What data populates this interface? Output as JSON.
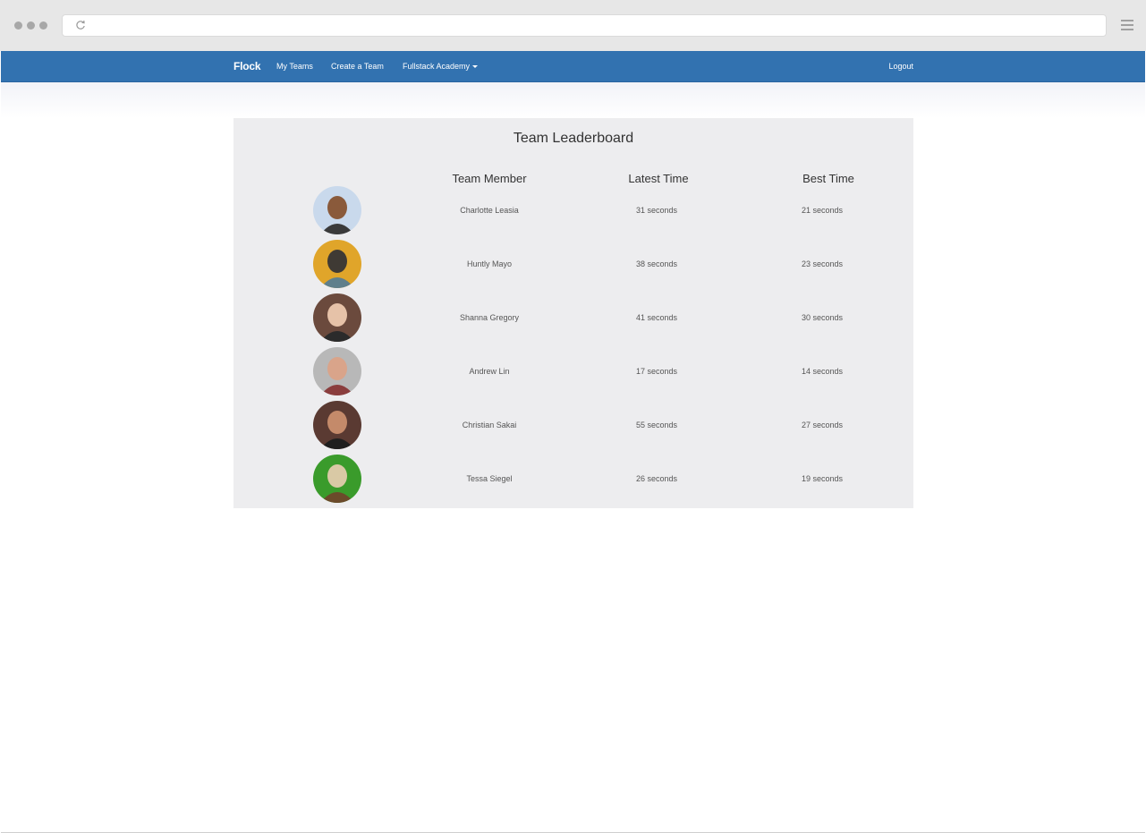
{
  "navbar": {
    "brand": "Flock",
    "links": [
      "My Teams",
      "Create a Team",
      "Fullstack Academy"
    ],
    "logout": "Logout"
  },
  "leaderboard": {
    "title": "Team Leaderboard",
    "headers": [
      "Team Member",
      "Latest Time",
      "Best Time"
    ],
    "rows": [
      {
        "name": "Charlotte Leasia",
        "latest": "31 seconds",
        "best": "21 seconds",
        "avatar_colors": [
          "#c9d9ec",
          "#8a5a3b",
          "#3a3a3a"
        ]
      },
      {
        "name": "Huntly Mayo",
        "latest": "38 seconds",
        "best": "23 seconds",
        "avatar_colors": [
          "#e0a52a",
          "#3f3a34",
          "#5f7f8c"
        ]
      },
      {
        "name": "Shanna Gregory",
        "latest": "41 seconds",
        "best": "30 seconds",
        "avatar_colors": [
          "#6b4a3d",
          "#e6c2a8",
          "#2b2b2b"
        ]
      },
      {
        "name": "Andrew Lin",
        "latest": "17 seconds",
        "best": "14 seconds",
        "avatar_colors": [
          "#b8b8b8",
          "#d9a48a",
          "#8a3d3d"
        ]
      },
      {
        "name": "Christian Sakai",
        "latest": "55 seconds",
        "best": "27 seconds",
        "avatar_colors": [
          "#5a3a32",
          "#c48a6a",
          "#1f1f1f"
        ]
      },
      {
        "name": "Tessa Siegel",
        "latest": "26 seconds",
        "best": "19 seconds",
        "avatar_colors": [
          "#3a9b2b",
          "#d9c9a5",
          "#6b4a2a"
        ]
      }
    ]
  }
}
